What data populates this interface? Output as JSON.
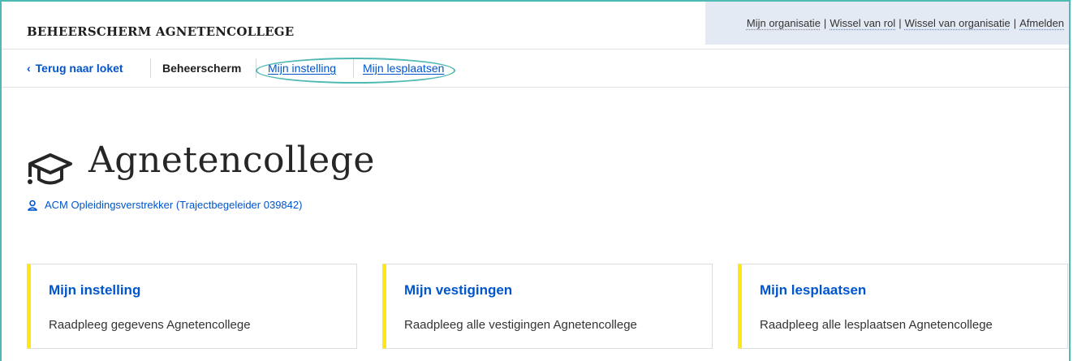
{
  "header": {
    "app_title": "BEHEERSCHERM AGNETENCOLLEGE",
    "utility_links": [
      "Mijn organisatie",
      "Wissel van rol",
      "Wissel van organisatie",
      "Afmelden"
    ]
  },
  "subnav": {
    "back_label": "Terug naar loket",
    "current_label": "Beheerscherm",
    "links": [
      "Mijn instelling",
      "Mijn lesplaatsen"
    ]
  },
  "org": {
    "icon": "graduation-cap-icon",
    "name": "Agnetencollege",
    "role": "ACM Opleidingsverstrekker (Trajectbegeleider 039842)"
  },
  "cards": [
    {
      "title": "Mijn instelling",
      "description": "Raadpleeg gegevens Agnetencollege"
    },
    {
      "title": "Mijn vestigingen",
      "description": "Raadpleeg alle vestigingen Agnetencollege"
    },
    {
      "title": "Mijn lesplaatsen",
      "description": "Raadpleeg alle lesplaatsen Agnetencollege"
    }
  ],
  "colors": {
    "link": "#0055cc",
    "accent": "#ffe615",
    "highlight": "#4fb9b4",
    "util_bg": "#e3eaf3"
  }
}
